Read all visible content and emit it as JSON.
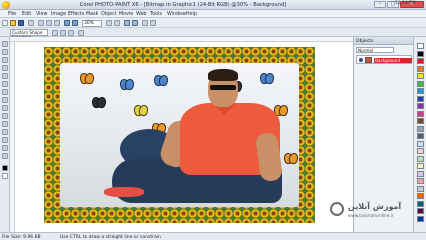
{
  "window": {
    "title": "Corel PHOTO-PAINT X6 - [Bitmap in Graphic1 (24-Bit RGB) @30% - Background]",
    "clock": "12:14 PM"
  },
  "menu": {
    "items": [
      "File",
      "Edit",
      "View",
      "Image",
      "Effects",
      "Mask",
      "Object",
      "Movie",
      "Web",
      "Tools",
      "Window",
      "Help"
    ]
  },
  "toolbar": {
    "zoom_value": "30%",
    "shape_mode_label": "Custom Shape Selection"
  },
  "docker": {
    "title": "Objects",
    "mode_label": "Normal",
    "layers": [
      {
        "name": "Background"
      }
    ]
  },
  "status": {
    "file_size": "File Size: 9.96 KB",
    "hint": "Use CTRL to draw a straight line or constrain"
  },
  "watermark": {
    "text": "آموزش آنلاین",
    "sub": "www.tutorialsonline.ir"
  },
  "palette": {
    "colors": [
      "#ffffff",
      "#000000",
      "#e21b1b",
      "#f07a16",
      "#f6e21a",
      "#49b847",
      "#1f9ad6",
      "#2b3ea8",
      "#8b2fa2",
      "#d83b8d",
      "#7a4b21",
      "#9aa3ad",
      "#58606a",
      "#c9e4f5",
      "#fbd0d0",
      "#b7e3b4",
      "#fff3b3",
      "#e0c2ec",
      "#ffa0a0",
      "#c8c8c8",
      "#ff6600",
      "#006666",
      "#660033",
      "#003399"
    ]
  }
}
